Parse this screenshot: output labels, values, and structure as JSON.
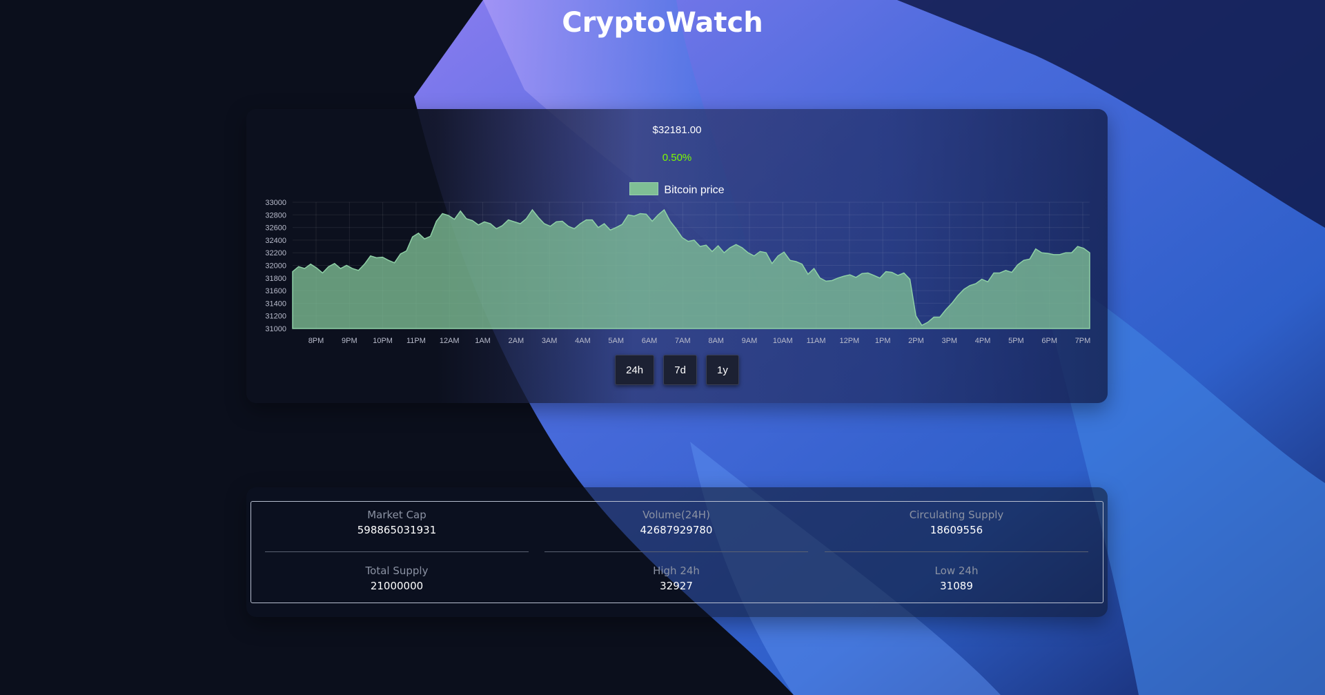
{
  "app": {
    "title": "CryptoWatch"
  },
  "price_display": {
    "price": "$32181.00",
    "change": "0.50%",
    "change_color": "#7cfc00"
  },
  "chart_data": {
    "type": "area",
    "legend": [
      "Bitcoin price"
    ],
    "series": [
      {
        "name": "Bitcoin price",
        "color": "#7fbf95",
        "values": [
          31900,
          31980,
          31950,
          32020,
          31960,
          31880,
          31980,
          32030,
          31950,
          32000,
          31950,
          31920,
          32020,
          32150,
          32120,
          32130,
          32080,
          32040,
          32180,
          32230,
          32450,
          32510,
          32420,
          32460,
          32700,
          32820,
          32790,
          32730,
          32860,
          32740,
          32710,
          32640,
          32690,
          32660,
          32580,
          32630,
          32720,
          32690,
          32660,
          32740,
          32880,
          32760,
          32660,
          32620,
          32690,
          32700,
          32620,
          32580,
          32660,
          32720,
          32720,
          32600,
          32660,
          32560,
          32600,
          32650,
          32800,
          32780,
          32820,
          32810,
          32700,
          32800,
          32880,
          32700,
          32580,
          32440,
          32380,
          32400,
          32300,
          32320,
          32220,
          32310,
          32200,
          32280,
          32330,
          32280,
          32200,
          32150,
          32220,
          32200,
          32030,
          32150,
          32210,
          32080,
          32060,
          32020,
          31860,
          31950,
          31800,
          31750,
          31760,
          31800,
          31830,
          31850,
          31810,
          31870,
          31880,
          31840,
          31800,
          31900,
          31890,
          31840,
          31880,
          31780,
          31200,
          31050,
          31100,
          31180,
          31180,
          31300,
          31400,
          31520,
          31620,
          31680,
          31710,
          31780,
          31740,
          31880,
          31880,
          31920,
          31890,
          32010,
          32080,
          32100,
          32260,
          32200,
          32190,
          32170,
          32170,
          32200,
          32200,
          32300,
          32270,
          32200
        ]
      }
    ],
    "x_tick_labels": [
      "8PM",
      "9PM",
      "10PM",
      "11PM",
      "12AM",
      "1AM",
      "2AM",
      "3AM",
      "4AM",
      "5AM",
      "6AM",
      "7AM",
      "8AM",
      "9AM",
      "10AM",
      "11AM",
      "12PM",
      "1PM",
      "2PM",
      "3PM",
      "4PM",
      "5PM",
      "6PM",
      "7PM"
    ],
    "y_tick_labels": [
      "33000",
      "32800",
      "32600",
      "32400",
      "32200",
      "32000",
      "31800",
      "31600",
      "31400",
      "31200",
      "31000"
    ],
    "ylim": [
      31000,
      33000
    ],
    "grid": true,
    "legend_position": "top-center"
  },
  "range_buttons": [
    {
      "label": "24h"
    },
    {
      "label": "7d"
    },
    {
      "label": "1y"
    }
  ],
  "stats": [
    {
      "label": "Market Cap",
      "value": "598865031931"
    },
    {
      "label": "Volume(24H)",
      "value": "42687929780"
    },
    {
      "label": "Circulating Supply",
      "value": "18609556"
    },
    {
      "label": "Total Supply",
      "value": "21000000"
    },
    {
      "label": "High 24h",
      "value": "32927"
    },
    {
      "label": "Low 24h",
      "value": "31089"
    }
  ]
}
